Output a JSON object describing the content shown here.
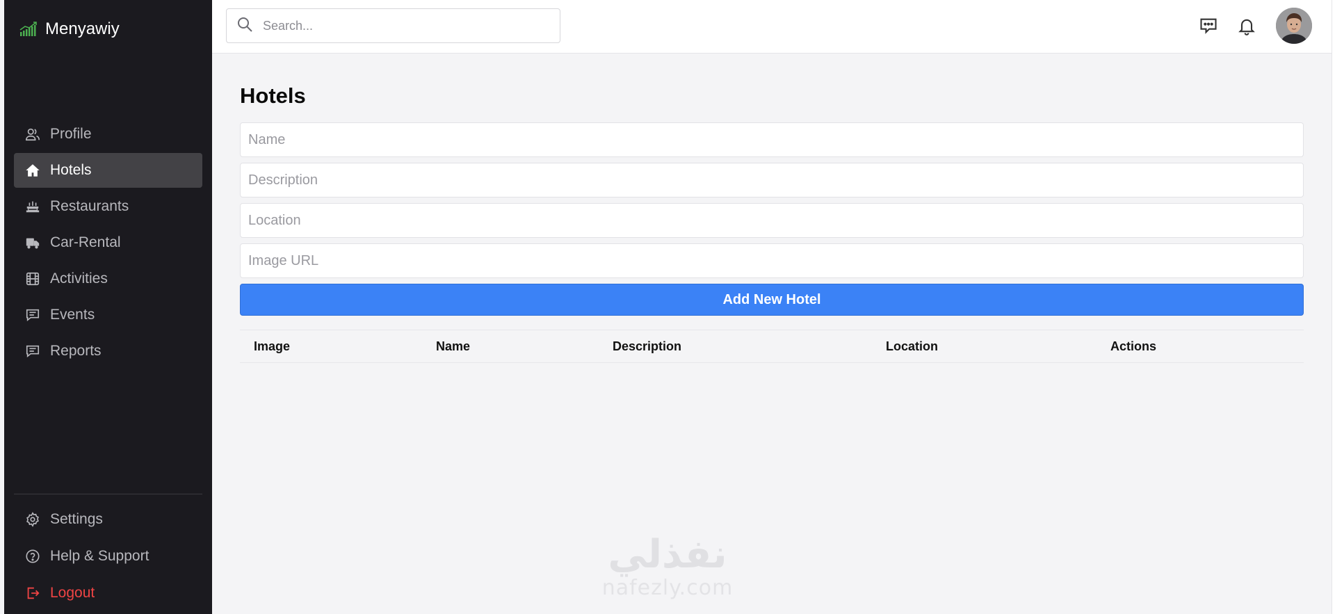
{
  "brand": {
    "name": "Menyawiy",
    "logo_icon": "bar-chart-icon",
    "logo_color": "#4caf50"
  },
  "search": {
    "placeholder": "Search..."
  },
  "header": {
    "icons": [
      "chat-icon",
      "bell-icon"
    ],
    "avatar": "user-avatar"
  },
  "sidebar": {
    "items": [
      {
        "label": "Profile",
        "icon": "user-icon",
        "active": false
      },
      {
        "label": "Hotels",
        "icon": "home-icon",
        "active": true
      },
      {
        "label": "Restaurants",
        "icon": "restaurant-icon",
        "active": false
      },
      {
        "label": "Car-Rental",
        "icon": "truck-icon",
        "active": false
      },
      {
        "label": "Activities",
        "icon": "film-icon",
        "active": false
      },
      {
        "label": "Events",
        "icon": "message-icon",
        "active": false
      },
      {
        "label": "Reports",
        "icon": "message-icon",
        "active": false
      }
    ],
    "bottom": [
      {
        "label": "Settings",
        "icon": "gear-icon"
      },
      {
        "label": "Help & Support",
        "icon": "help-icon"
      },
      {
        "label": "Logout",
        "icon": "logout-icon",
        "color": "#ef4444"
      }
    ]
  },
  "main": {
    "title": "Hotels",
    "fields": [
      {
        "placeholder": "Name",
        "value": ""
      },
      {
        "placeholder": "Description",
        "value": ""
      },
      {
        "placeholder": "Location",
        "value": ""
      },
      {
        "placeholder": "Image URL",
        "value": ""
      }
    ],
    "add_button": "Add New Hotel",
    "accent": "#3b82f6",
    "table": {
      "columns": [
        "Image",
        "Name",
        "Description",
        "Location",
        "Actions"
      ],
      "rows": []
    }
  },
  "watermark": {
    "arabic": "نفذلي",
    "latin": "nafezly.com"
  }
}
